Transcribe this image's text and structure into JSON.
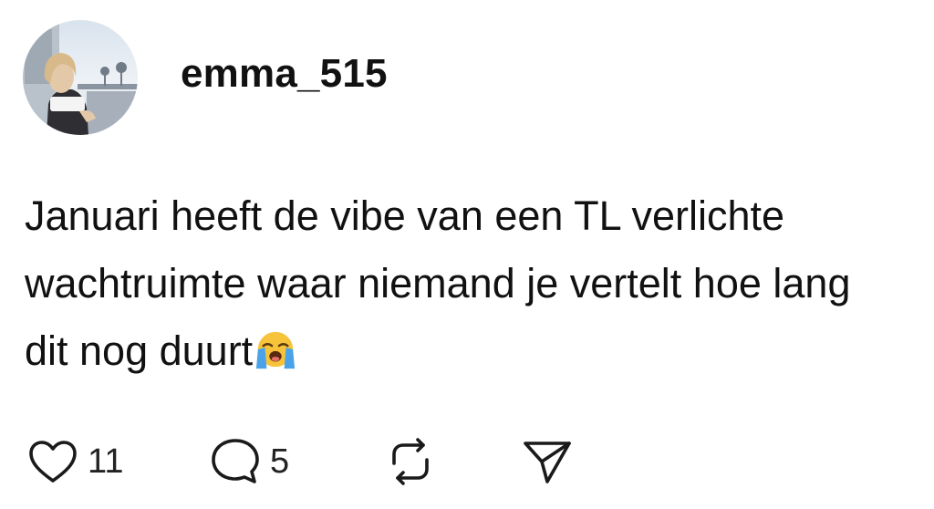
{
  "post": {
    "username": "emma_515",
    "text": "Januari heeft de vibe van een TL verlichte wachtruimte waar niemand je vertelt hoe lang dit nog duurt",
    "emoji": "loudly-crying-face",
    "avatar_alt": "profile photo"
  },
  "actions": {
    "like_count": "11",
    "reply_count": "5",
    "icons": [
      "heart-icon",
      "reply-bubble-icon",
      "repost-icon",
      "share-send-icon"
    ]
  },
  "colors": {
    "text": "#111111",
    "icon": "#1a1a1a",
    "emoji_face": "#f7c33a",
    "emoji_tears": "#4aa3e8"
  }
}
